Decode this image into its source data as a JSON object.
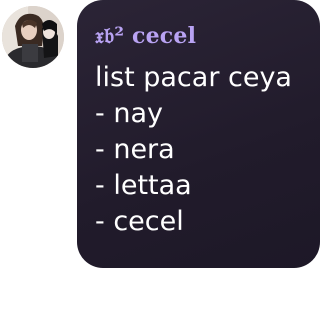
{
  "message": {
    "sender_name": "𝔵𝔟² cecel",
    "lines": [
      "list pacar ceya",
      "- nay",
      "- nera",
      "- lettaa",
      "- cecel"
    ]
  },
  "colors": {
    "bubble": "#241e2f",
    "sender_name": "#b9a3f3",
    "message_text": "#ffffff"
  }
}
